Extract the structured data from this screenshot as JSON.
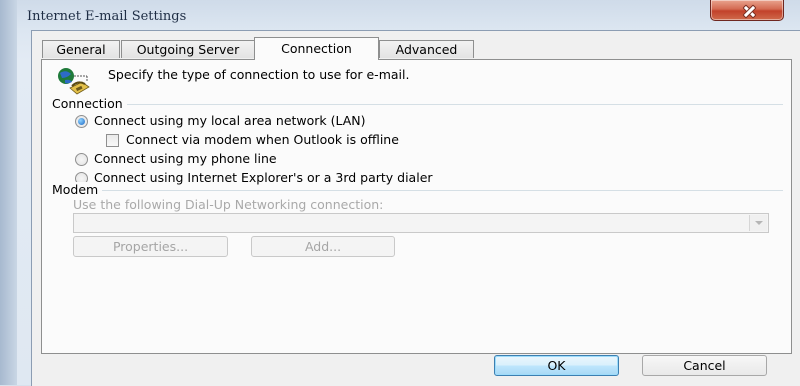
{
  "window": {
    "title": "Internet E-mail Settings"
  },
  "tabs": [
    {
      "label": "General"
    },
    {
      "label": "Outgoing Server"
    },
    {
      "label": "Connection"
    },
    {
      "label": "Advanced"
    }
  ],
  "active_tab": "Connection",
  "intro": {
    "text": "Specify the type of connection to use for e-mail.",
    "icon": "network-phone-icon"
  },
  "connection": {
    "group_label": "Connection",
    "options": [
      {
        "label": "Connect using my local area network (LAN)",
        "checked": true
      },
      {
        "label": "Connect using my phone line",
        "checked": false
      },
      {
        "label": "Connect using Internet Explorer's or a 3rd party dialer",
        "checked": false
      }
    ],
    "modem_offline_checkbox": {
      "label": "Connect via modem when Outlook is offline",
      "checked": false
    }
  },
  "modem": {
    "group_label": "Modem",
    "dialup_label": "Use the following Dial-Up Networking connection:",
    "dialup_value": "",
    "properties_button": "Properties...",
    "add_button": "Add..."
  },
  "footer": {
    "ok_button": "OK",
    "cancel_button": "Cancel"
  },
  "colors": {
    "close_button": "#c2412a",
    "radio_selected": "#1c67c4",
    "default_button_border": "#3c7fb1"
  }
}
